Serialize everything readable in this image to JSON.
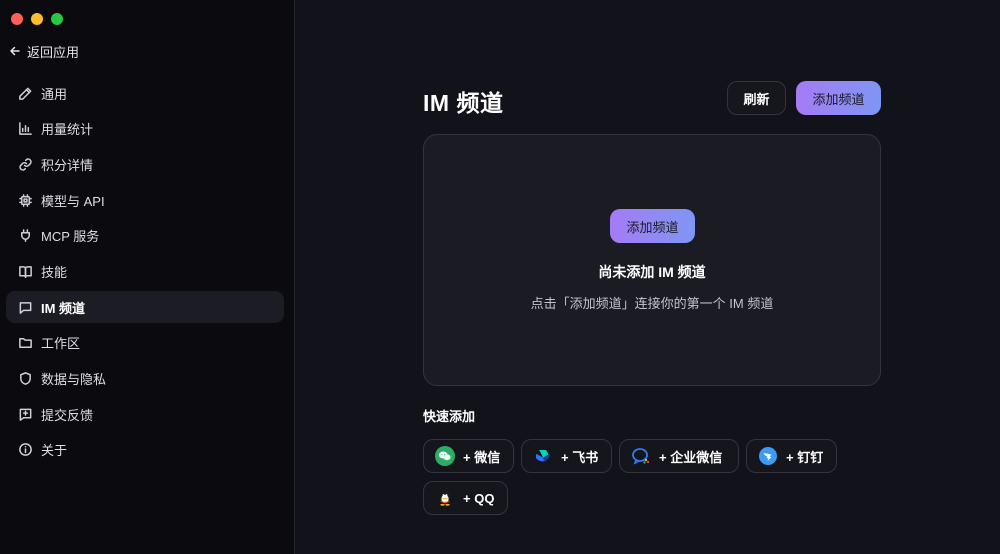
{
  "window": {
    "back_label": "返回应用"
  },
  "sidebar": {
    "items": [
      {
        "label": "通用",
        "icon": "pencil-icon"
      },
      {
        "label": "用量统计",
        "icon": "bar-chart-icon"
      },
      {
        "label": "积分详情",
        "icon": "link-icon"
      },
      {
        "label": "模型与 API",
        "icon": "chip-icon"
      },
      {
        "label": "MCP 服务",
        "icon": "plug-icon"
      },
      {
        "label": "技能",
        "icon": "book-icon"
      },
      {
        "label": "IM 频道",
        "icon": "message-icon",
        "active": true
      },
      {
        "label": "工作区",
        "icon": "folder-icon"
      },
      {
        "label": "数据与隐私",
        "icon": "shield-icon"
      },
      {
        "label": "提交反馈",
        "icon": "feedback-icon"
      },
      {
        "label": "关于",
        "icon": "info-icon"
      }
    ]
  },
  "main": {
    "title": "IM 频道",
    "refresh_label": "刷新",
    "add_label": "添加频道",
    "empty": {
      "button_label": "添加频道",
      "title": "尚未添加 IM 频道",
      "description": "点击「添加频道」连接你的第一个 IM 频道"
    },
    "quick_add": {
      "title": "快速添加",
      "items": [
        {
          "label": "+ 微信",
          "icon": "wechat-icon"
        },
        {
          "label": "+ 飞书",
          "icon": "feishu-icon"
        },
        {
          "label": "+ 企业微信",
          "icon": "wecom-icon"
        },
        {
          "label": "+ 钉钉",
          "icon": "dingtalk-icon"
        },
        {
          "label": "+ QQ",
          "icon": "qq-icon"
        }
      ]
    }
  },
  "colors": {
    "accent_start": "#a57bf5",
    "accent_end": "#7f96f3",
    "background": "#12121a",
    "sidebar": "#0b0b0f"
  }
}
